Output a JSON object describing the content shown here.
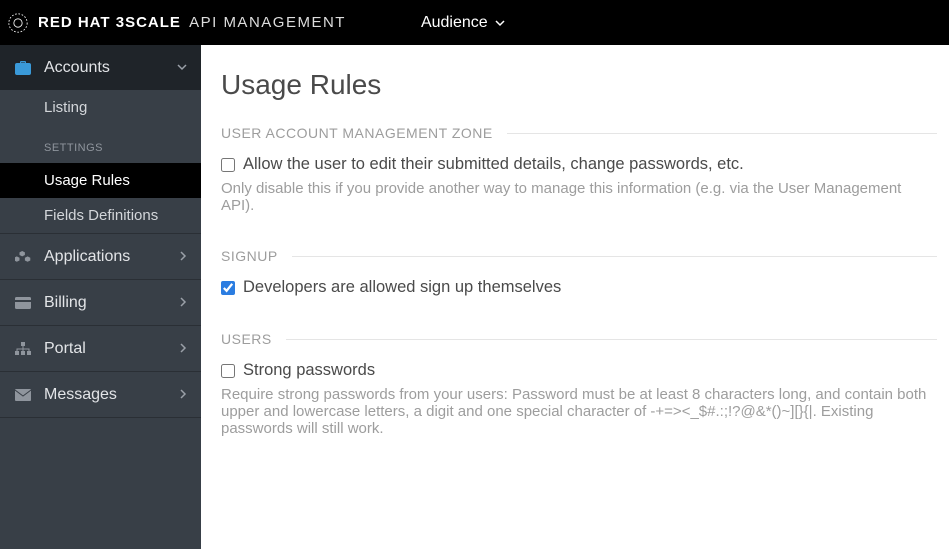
{
  "header": {
    "brand1": "RED HAT",
    "brand2": "3SCALE",
    "brand3": "API MANAGEMENT",
    "audience_label": "Audience"
  },
  "sidebar": {
    "accounts": {
      "label": "Accounts",
      "sub_listing": "Listing",
      "sub_settings_header": "Settings",
      "sub_usage_rules": "Usage Rules",
      "sub_fields": "Fields Definitions"
    },
    "applications": "Applications",
    "billing": "Billing",
    "portal": "Portal",
    "messages": "Messages"
  },
  "main": {
    "title": "Usage Rules",
    "sec1": {
      "heading": "USER ACCOUNT MANAGEMENT ZONE",
      "checkbox_label": "Allow the user to edit their submitted details, change passwords, etc.",
      "hint": "Only disable this if you provide another way to manage this information (e.g. via the User Management API).",
      "checked": false
    },
    "sec2": {
      "heading": "SIGNUP",
      "checkbox_label": "Developers are allowed sign up themselves",
      "checked": true
    },
    "sec3": {
      "heading": "USERS",
      "checkbox_label": "Strong passwords",
      "hint": "Require strong passwords from your users: Password must be at least 8 characters long, and contain both upper and lowercase letters, a digit and one special character of -+=><_$#.:;!?@&*()~][}{|. Existing passwords will still work.",
      "checked": false
    }
  }
}
